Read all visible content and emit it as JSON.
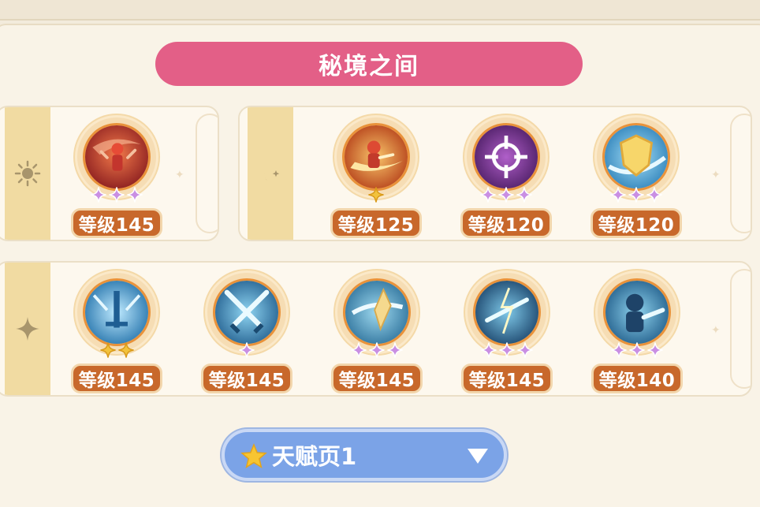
{
  "title": "秘境之间",
  "colors": {
    "title_banner": "#e35f87",
    "level_badge": "#c8682b",
    "select_bg": "#7ba3e7",
    "star_purple": "#c98fe3",
    "star_gold": "#f2c23c",
    "tab_bg": "#f1dba2"
  },
  "rows": [
    {
      "groups": [
        {
          "tab_icon": "sun-icon",
          "skills": [
            {
              "icon": "fire-hero-icon",
              "level": "等级145",
              "stars": 3,
              "star_color": "purple"
            }
          ]
        },
        {
          "tab_icon": "crescent-moon-icon",
          "skills": [
            {
              "icon": "fire-dash-icon",
              "level": "等级125",
              "stars": 1,
              "star_color": "gold"
            },
            {
              "icon": "crosshair-icon",
              "level": "等级120",
              "stars": 3,
              "star_color": "purple"
            },
            {
              "icon": "shield-icon",
              "level": "等级120",
              "stars": 3,
              "star_color": "purple"
            }
          ]
        }
      ]
    },
    {
      "groups": [
        {
          "tab_icon": "four-point-star-icon",
          "skills": [
            {
              "icon": "ice-sword-icon",
              "level": "等级145",
              "stars": 2,
              "star_color": "gold"
            },
            {
              "icon": "crossed-swords-icon",
              "level": "等级145",
              "stars": 1,
              "star_color": "purple"
            },
            {
              "icon": "wind-crystal-icon",
              "level": "等级145",
              "stars": 3,
              "star_color": "purple"
            },
            {
              "icon": "lightning-icon",
              "level": "等级145",
              "stars": 3,
              "star_color": "purple"
            },
            {
              "icon": "warrior-icon",
              "level": "等级140",
              "stars": 3,
              "star_color": "purple"
            }
          ]
        }
      ]
    }
  ],
  "talent_select": {
    "icon": "gold-star-icon",
    "label": "天赋页1",
    "dropdown_icon": "triangle-down-icon"
  }
}
